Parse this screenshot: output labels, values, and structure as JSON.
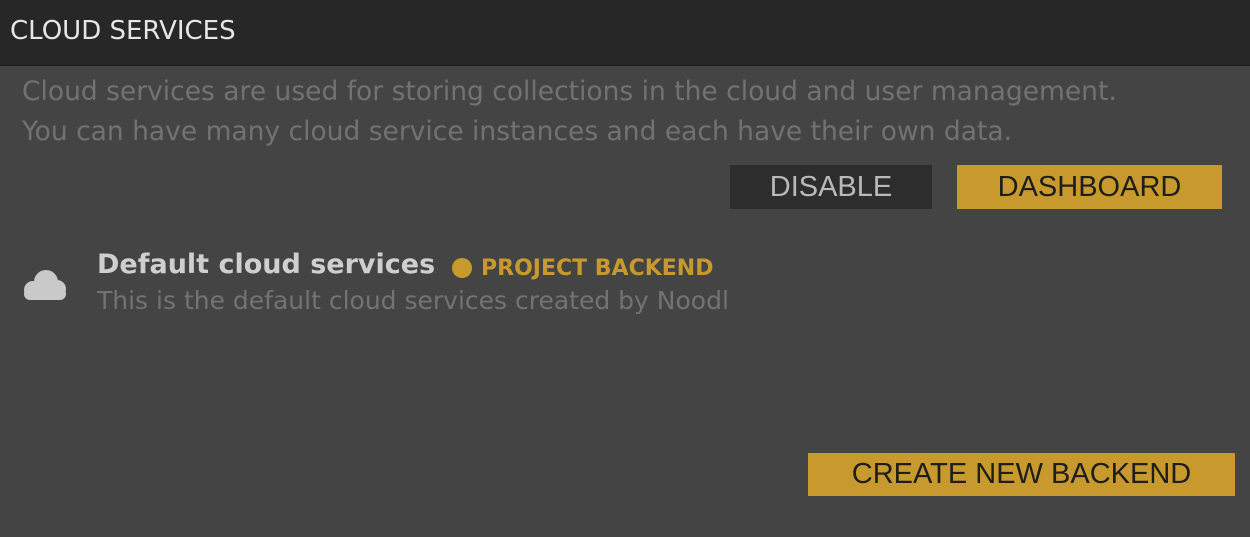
{
  "header": {
    "title": "CLOUD SERVICES"
  },
  "description": {
    "line1": "Cloud services are used for storing collections in the cloud and user management.",
    "line2": "You can have many cloud service instances and each have their own data."
  },
  "actions": {
    "disable_label": "DISABLE",
    "dashboard_label": "DASHBOARD"
  },
  "services": [
    {
      "icon": "cloud-icon",
      "name": "Default cloud services",
      "badge": "PROJECT BACKEND",
      "description": "This is the default cloud services created by Noodl"
    }
  ],
  "footer": {
    "create_label": "CREATE NEW BACKEND"
  },
  "colors": {
    "accent": "#c8992c",
    "header_bg": "#272727",
    "panel_bg": "#444444",
    "disable_bg": "#2d2d2d"
  }
}
